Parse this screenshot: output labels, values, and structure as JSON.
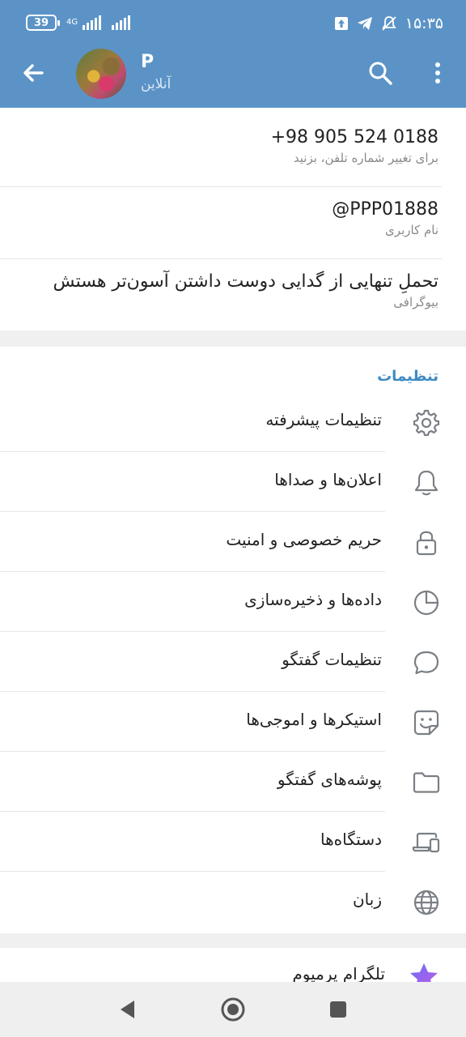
{
  "status_bar": {
    "battery": "39",
    "network": "4G",
    "time": "۱۵:۳۵"
  },
  "app_bar": {
    "name": "P",
    "presence": "آنلاین"
  },
  "info": {
    "phone": {
      "value": "+98 905 524 0188",
      "label": "برای تغییر شماره تلفن، بزنید"
    },
    "username": {
      "value": "@PPP01888",
      "label": "نام کاربری"
    },
    "bio": {
      "value": "تحملِ تنهایی از گدایی دوست داشتن آسون‌تر هستش",
      "label": "بیوگرافی"
    }
  },
  "settings": {
    "title": "تنظیمات",
    "items": [
      {
        "label": "تنظیمات پیشرفته",
        "icon": "gear-icon"
      },
      {
        "label": "اعلان‌ها و صداها",
        "icon": "bell-icon"
      },
      {
        "label": "حریم خصوصی و امنیت",
        "icon": "lock-icon"
      },
      {
        "label": "داده‌ها و ذخیره‌سازی",
        "icon": "pie-chart-icon"
      },
      {
        "label": "تنظیمات گفتگو",
        "icon": "chat-bubble-icon"
      },
      {
        "label": "استیکرها و اموجی‌ها",
        "icon": "sticker-icon"
      },
      {
        "label": "پوشه‌های گفتگو",
        "icon": "folder-icon"
      },
      {
        "label": "دستگاه‌ها",
        "icon": "devices-icon"
      },
      {
        "label": "زبان",
        "icon": "globe-icon"
      }
    ]
  },
  "premium": {
    "label": "تلگرام پرمیوم",
    "icon": "star-icon"
  },
  "colors": {
    "header": "#5b93c7",
    "accent": "#3e8ac4",
    "premium": "#8a5cf0"
  }
}
